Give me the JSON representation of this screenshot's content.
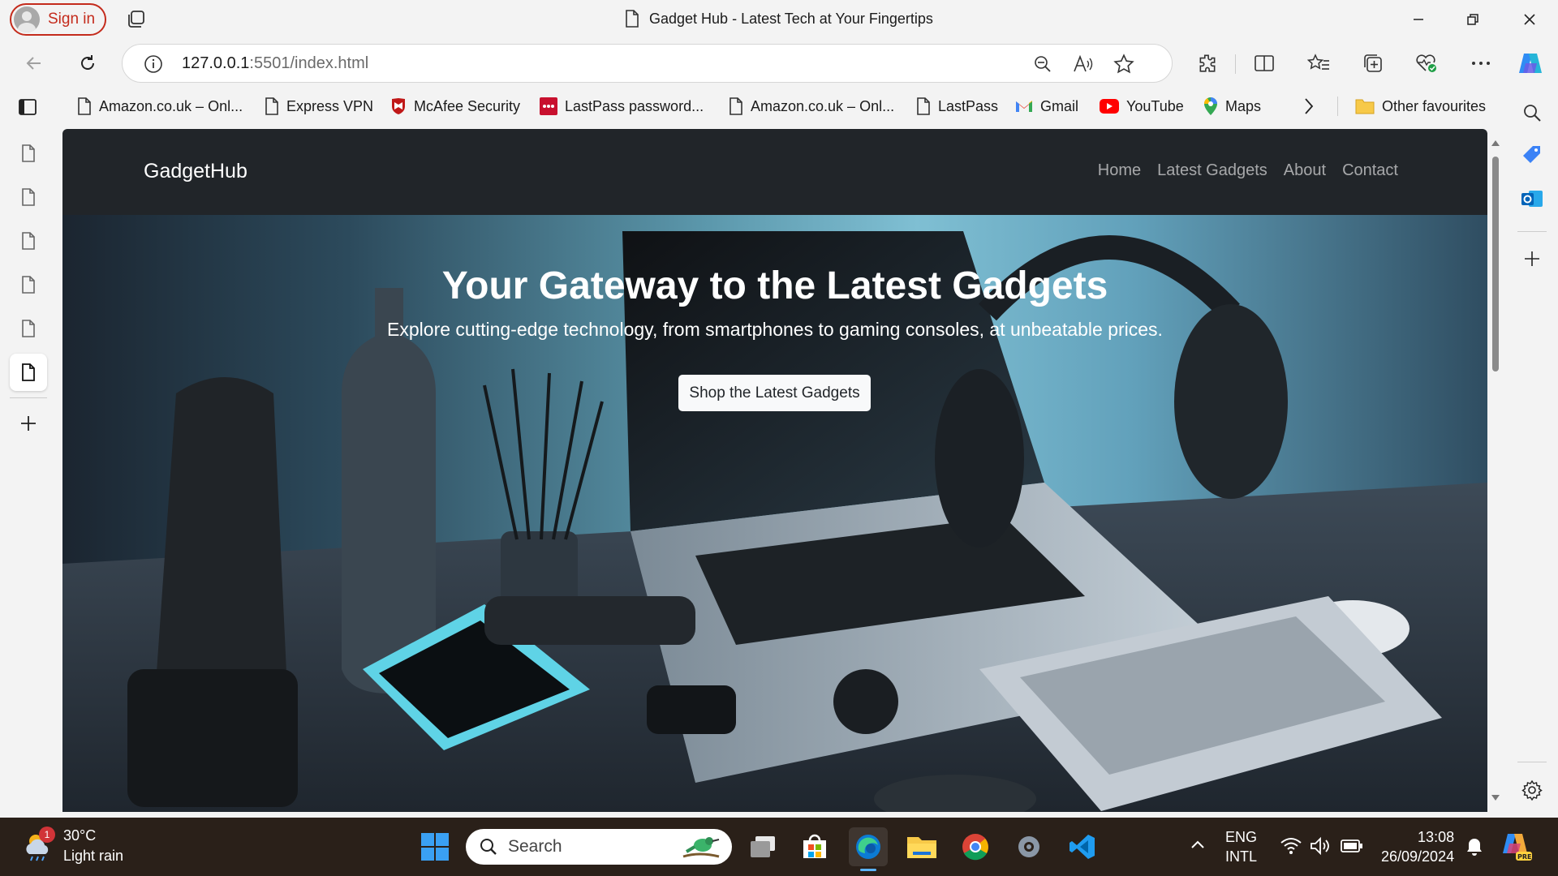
{
  "browser": {
    "signin_label": "Sign in",
    "window_title": "Gadget Hub - Latest Tech at Your Fingertips",
    "url_host": "127.0.0.1",
    "url_path": ":5501/index.html"
  },
  "favourites": [
    {
      "label": "Amazon.co.uk – Onl...",
      "icon": "page-icon"
    },
    {
      "label": "Express VPN",
      "icon": "page-icon"
    },
    {
      "label": "McAfee Security",
      "icon": "mcafee-icon"
    },
    {
      "label": "LastPass password...",
      "icon": "lastpass-icon"
    },
    {
      "label": "Amazon.co.uk – Onl...",
      "icon": "page-icon"
    },
    {
      "label": "LastPass",
      "icon": "page-icon"
    },
    {
      "label": "Gmail",
      "icon": "gmail-icon"
    },
    {
      "label": "YouTube",
      "icon": "youtube-icon"
    },
    {
      "label": "Maps",
      "icon": "maps-icon"
    }
  ],
  "other_favourites": "Other favourites",
  "site": {
    "brand": "GadgetHub",
    "nav": [
      "Home",
      "Latest Gadgets",
      "About",
      "Contact"
    ],
    "hero_title": "Your Gateway to the Latest Gadgets",
    "hero_subtitle": "Explore cutting-edge technology, from smartphones to gaming consoles, at unbeatable prices.",
    "hero_button": "Shop the Latest Gadgets"
  },
  "taskbar": {
    "weather_temp": "30°C",
    "weather_desc": "Light rain",
    "weather_badge": "1",
    "search_placeholder": "Search",
    "lang_line1": "ENG",
    "lang_line2": "INTL",
    "time": "13:08",
    "date": "26/09/2024"
  },
  "colors": {
    "signin_accent": "#c42b1c",
    "site_nav_bg": "#212529",
    "taskbar_bg": "#2a2019"
  }
}
